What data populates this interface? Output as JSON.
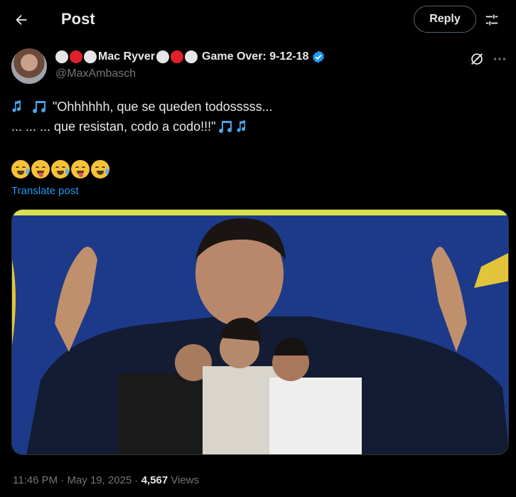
{
  "header": {
    "title": "Post",
    "reply_label": "Reply"
  },
  "author": {
    "name_part1": "Mac Ryver",
    "name_part2": "Game Over: 9-12-18",
    "handle": "@MaxAmbasch"
  },
  "tweet": {
    "line1": "\"Ohhhhhh, que se queden todosssss...",
    "line2": "... ... ... que resistan, codo a codo!!!\"",
    "translate_label": "Translate post"
  },
  "meta": {
    "time": "11:46 PM",
    "separator1": " · ",
    "date": "May 19, 2025",
    "separator2": " · ",
    "views_count": "4,567",
    "views_label": " Views"
  },
  "colors": {
    "accent": "#1d9bf0",
    "verified": "#1d9bf0",
    "background": "#000000",
    "text": "#e7e9ea",
    "muted": "#71767b",
    "media_bg": "#1d3a8a",
    "media_top_stripe": "#d9e24a"
  },
  "icons": {
    "back": "arrow-left-icon",
    "settings": "sliders-icon",
    "verified": "verified-badge-icon",
    "grok": "grok-icon",
    "more": "more-horizontal-icon",
    "music": "music-notes-icon"
  }
}
